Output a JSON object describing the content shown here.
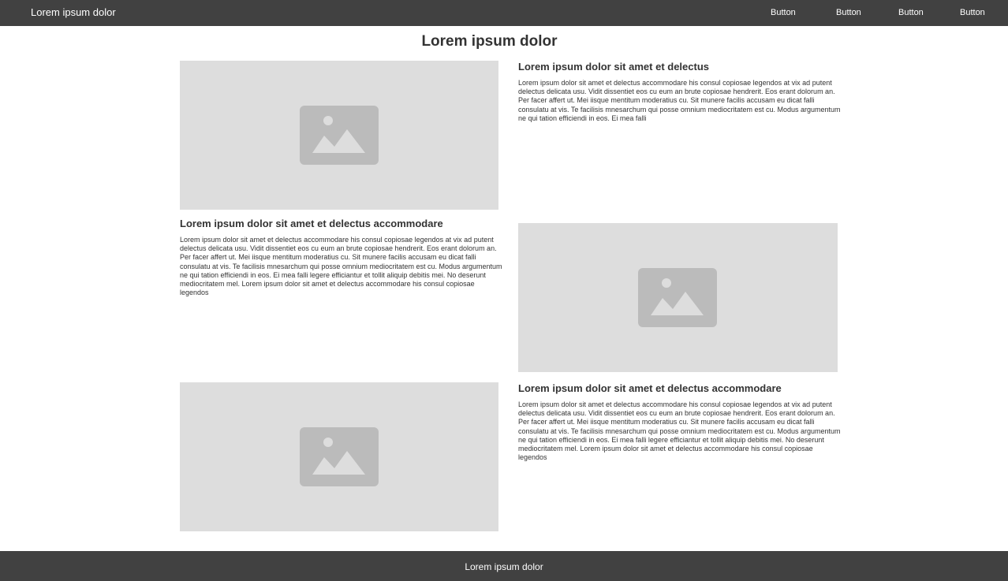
{
  "header": {
    "brand": "Lorem ipsum dolor",
    "nav_buttons": [
      "Button",
      "Button",
      "Button",
      "Button"
    ]
  },
  "main": {
    "title": "Lorem ipsum dolor",
    "sections": [
      {
        "title": "Lorem ipsum dolor sit amet et delectus",
        "body": "Lorem ipsum dolor sit amet et delectus accommodare his consul copiosae legendos at vix ad putent delectus delicata usu. Vidit dissentiet eos cu eum an brute copiosae hendrerit. Eos erant dolorum an. Per facer affert ut. Mei iisque mentitum moderatius cu. Sit munere facilis accusam eu dicat falli consulatu at vis. Te facilisis mnesarchum qui posse omnium mediocritatem est cu. Modus argumentum ne qui tation efficiendi in eos. Ei mea falli"
      },
      {
        "title": "Lorem ipsum dolor sit amet et delectus accommodare",
        "body": "Lorem ipsum dolor sit amet et delectus accommodare his consul copiosae legendos at vix ad putent delectus delicata usu. Vidit dissentiet eos cu eum an brute copiosae hendrerit. Eos erant dolorum an. Per facer affert ut. Mei iisque mentitum moderatius cu. Sit munere facilis accusam eu dicat falli consulatu at vis. Te facilisis mnesarchum qui posse omnium mediocritatem est cu. Modus argumentum ne qui tation efficiendi in eos. Ei mea falli legere efficiantur et tollit aliquip debitis mei. No deserunt mediocritatem mel. Lorem ipsum dolor sit amet et delectus accommodare his consul copiosae legendos"
      },
      {
        "title": "Lorem ipsum dolor sit amet et delectus accommodare",
        "body": "Lorem ipsum dolor sit amet et delectus accommodare his consul copiosae legendos at vix ad putent delectus delicata usu. Vidit dissentiet eos cu eum an brute copiosae hendrerit. Eos erant dolorum an. Per facer affert ut. Mei iisque mentitum moderatius cu. Sit munere facilis accusam eu dicat falli consulatu at vis. Te facilisis mnesarchum qui posse omnium mediocritatem est cu. Modus argumentum ne qui tation efficiendi in eos. Ei mea falli legere efficiantur et tollit aliquip debitis mei. No deserunt mediocritatem mel. Lorem ipsum dolor sit amet et delectus accommodare his consul copiosae legendos"
      }
    ],
    "image_icon": "image-placeholder-icon"
  },
  "footer": {
    "text": "Lorem ipsum dolor"
  },
  "colors": {
    "bar": "#414141",
    "placeholder_bg": "#dddddd",
    "placeholder_icon": "#bbbbbb",
    "text": "#333333"
  }
}
